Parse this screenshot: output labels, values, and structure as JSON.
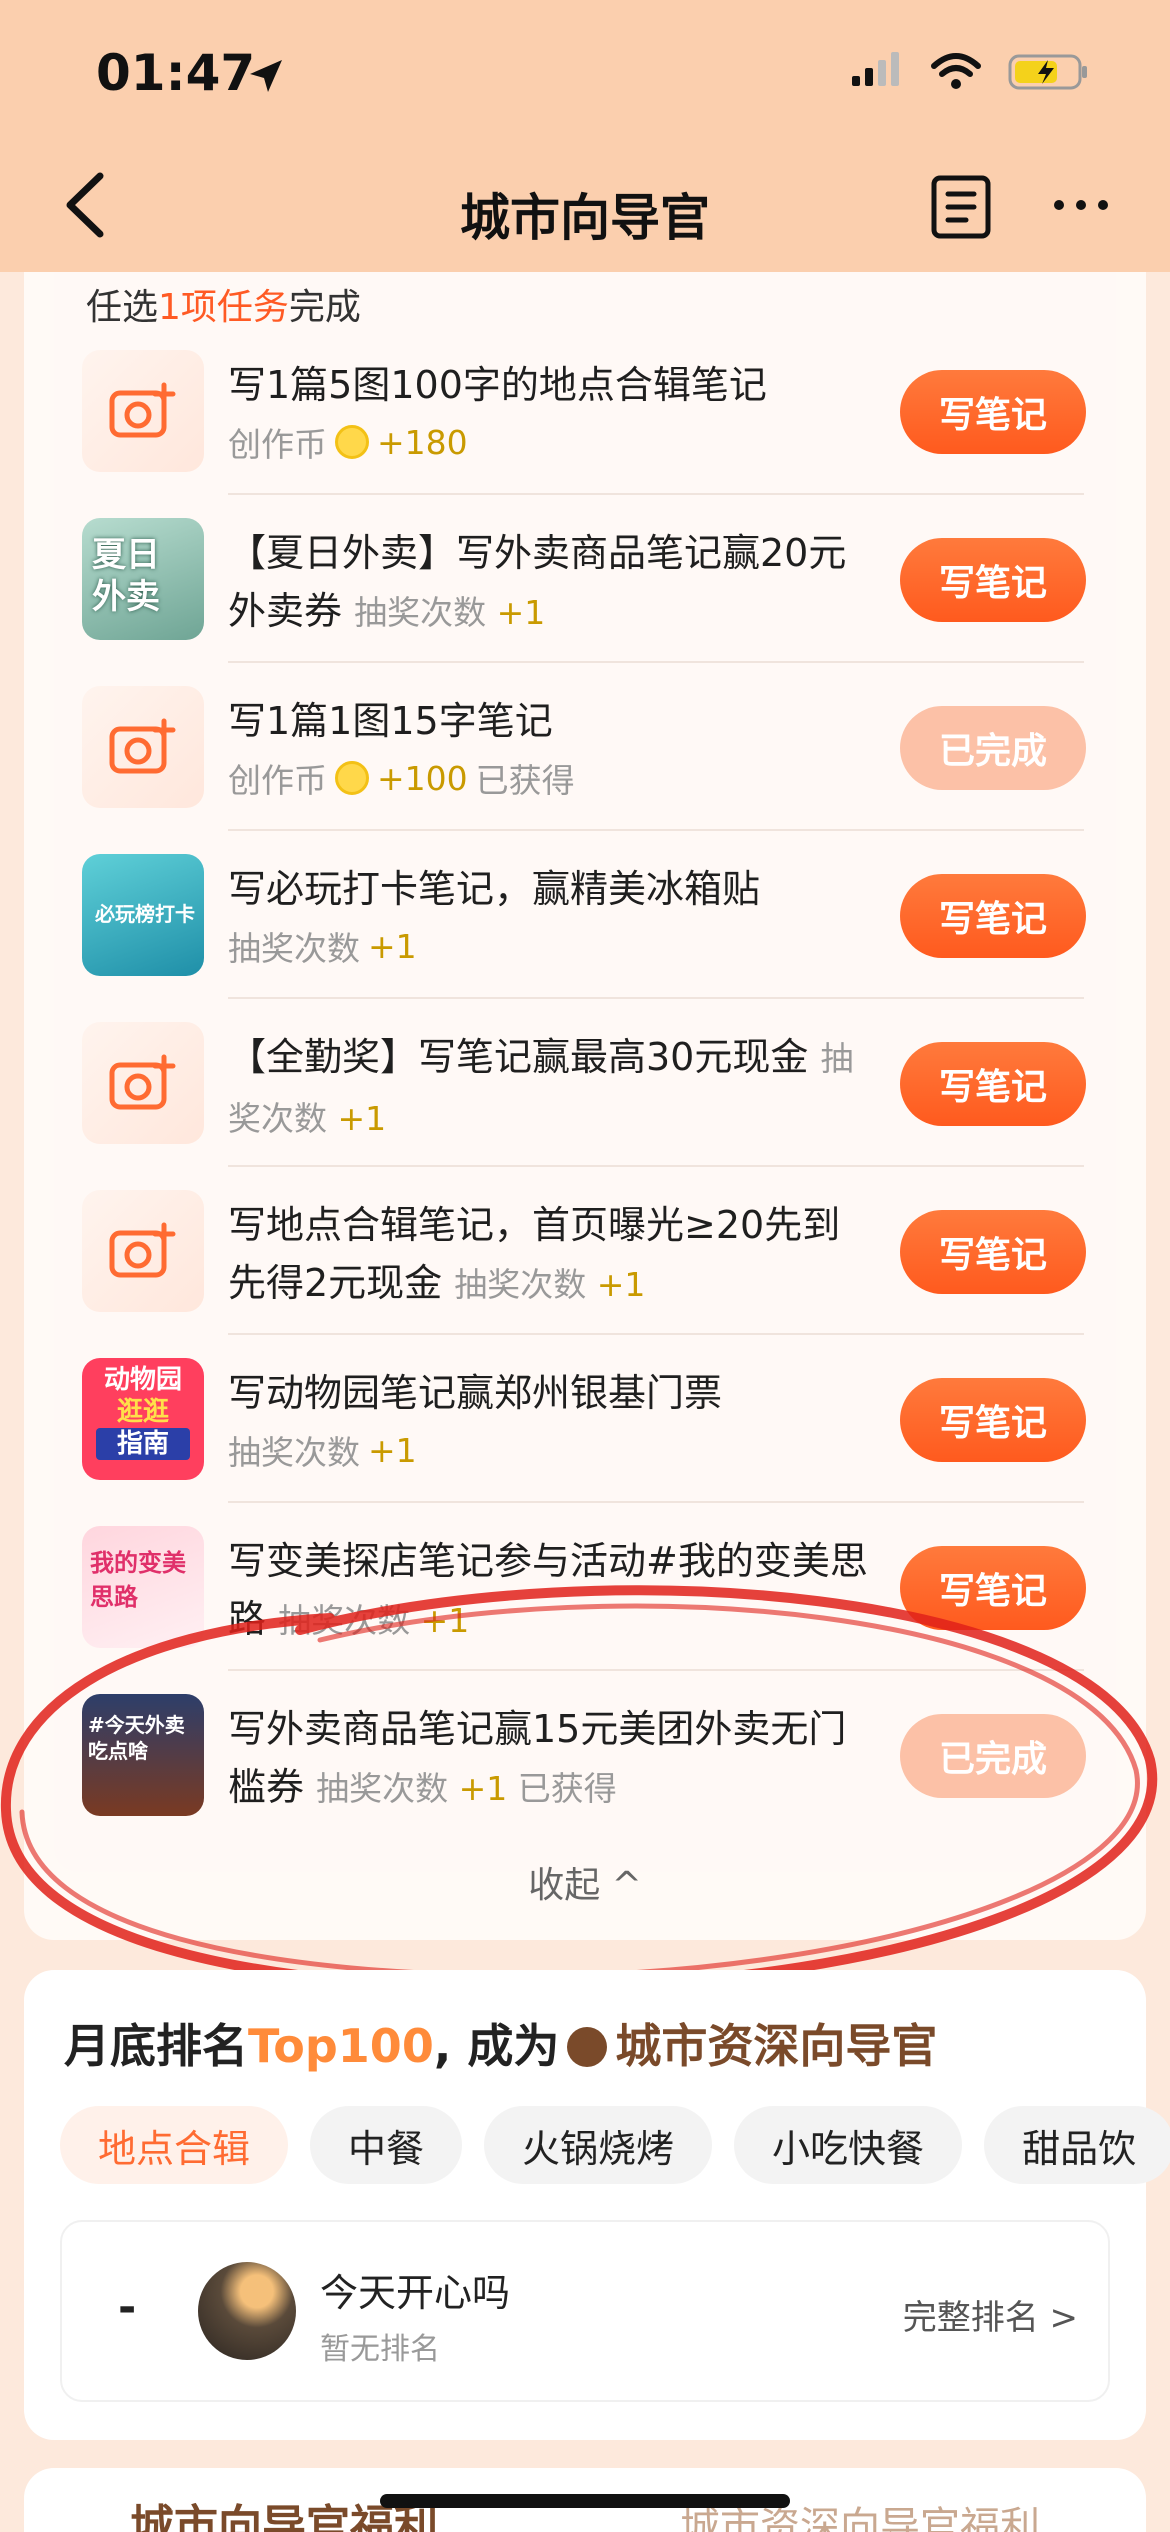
{
  "status": {
    "time": "01:47"
  },
  "nav": {
    "title": "城市向导官"
  },
  "task_section": {
    "hint_prefix": "任选",
    "hint_highlight": "1项任务",
    "hint_suffix": "完成",
    "collapse_label": "收起 ^"
  },
  "tasks": [
    {
      "title": "写1篇5图100字的地点合辑笔记",
      "meta_label": "创作币",
      "meta_value": "+180",
      "meta_extra": "",
      "button": "写笔记",
      "done": false
    },
    {
      "title": "【夏日外卖】写外卖商品笔记赢20元外卖券",
      "meta_label": "抽奖次数",
      "meta_value": "+1",
      "meta_extra": "",
      "button": "写笔记",
      "done": false
    },
    {
      "title": "写1篇1图15字笔记",
      "meta_label": "创作币",
      "meta_value": "+100",
      "meta_extra": "已获得",
      "button": "已完成",
      "done": true
    },
    {
      "title": "写必玩打卡笔记，赢精美冰箱贴",
      "meta_label": "抽奖次数",
      "meta_value": "+1",
      "meta_extra": "",
      "button": "写笔记",
      "done": false
    },
    {
      "title": "【全勤奖】写笔记赢最高30元现金",
      "meta_label": "抽奖次数",
      "meta_value": "+1",
      "meta_extra": "",
      "button": "写笔记",
      "done": false
    },
    {
      "title": "写地点合辑笔记，首页曝光≥20先到先得2元现金",
      "meta_label": "抽奖次数",
      "meta_value": "+1",
      "meta_extra": "",
      "button": "写笔记",
      "done": false
    },
    {
      "title": "写动物园笔记赢郑州银基门票",
      "meta_label": "抽奖次数",
      "meta_value": "+1",
      "meta_extra": "",
      "button": "写笔记",
      "done": false
    },
    {
      "title": "写变美探店笔记参与活动#我的变美思路",
      "meta_label": "抽奖次数",
      "meta_value": "+1",
      "meta_extra": "",
      "button": "写笔记",
      "done": false
    },
    {
      "title": "写外卖商品笔记赢15元美团外卖无门槛券",
      "meta_label": "抽奖次数",
      "meta_value": "+1",
      "meta_extra": "已获得",
      "button": "已完成",
      "done": true
    }
  ],
  "thumb_texts": {
    "t1": "夏日外卖",
    "t3": "必玩榜打卡",
    "t6a": "动物园",
    "t6b": "逛逛",
    "t6c": "指南",
    "t7": "我的变美思路",
    "t8": "#今天外卖吃点啥"
  },
  "ranking": {
    "title_prefix": "月底排名",
    "title_highlight": "Top100",
    "title_mid": ", 成为",
    "title_suffix": "城市资深向导官",
    "chips": [
      "地点合辑",
      "中餐",
      "火锅烧烤",
      "小吃快餐",
      "甜品饮"
    ],
    "user": {
      "rank": "-",
      "name": "今天开心吗",
      "sub": "暂无排名",
      "full_rank": "完整排名 >"
    }
  },
  "bottom": {
    "left": "城市向导官福利",
    "right": "城市资深向导官福利"
  },
  "colors": {
    "accent": "#ff5a1e",
    "header_bg": "#fbcfae",
    "annotation": "#e0211a"
  }
}
